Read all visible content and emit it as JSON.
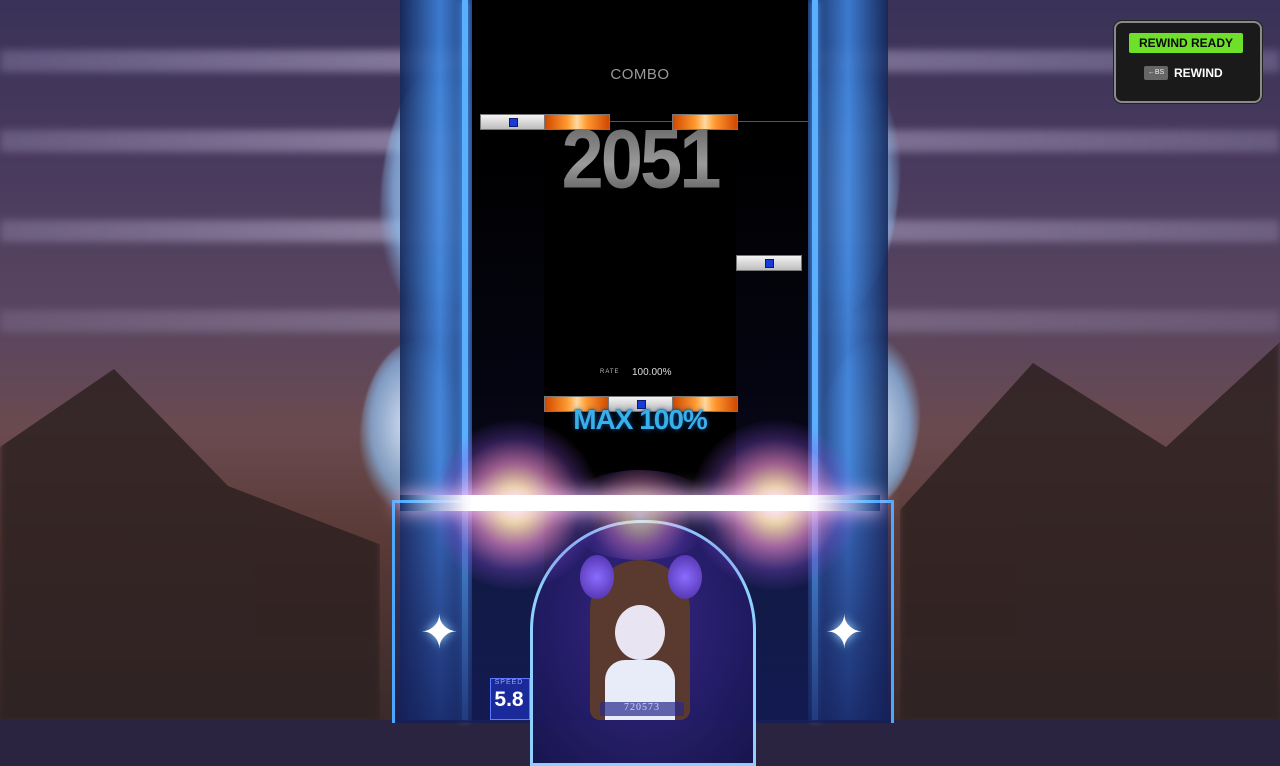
{
  "hud": {
    "combo_label": "COMBO",
    "combo_count": "2051",
    "rate_label": "RATE",
    "rate_value": "100.00%",
    "judgement_text": "MAX 100%"
  },
  "speed": {
    "label": "SPEED",
    "value": "5.8"
  },
  "score": {
    "value": "720573"
  },
  "rewind": {
    "ready_label": "REWIND READY",
    "key_label": "←BS",
    "action_label": "REWIND"
  },
  "icons": [
    "sparkle-icon",
    "backspace-key-icon"
  ],
  "colors": {
    "rewind_ready_bg": "#6ee02a",
    "note_orange": "#ff9a30",
    "note_white": "#e0e0e0",
    "note_marker": "#1a3ad8",
    "frame_blue": "#4aa8ff",
    "judgement_text": "#3ab0e8"
  }
}
